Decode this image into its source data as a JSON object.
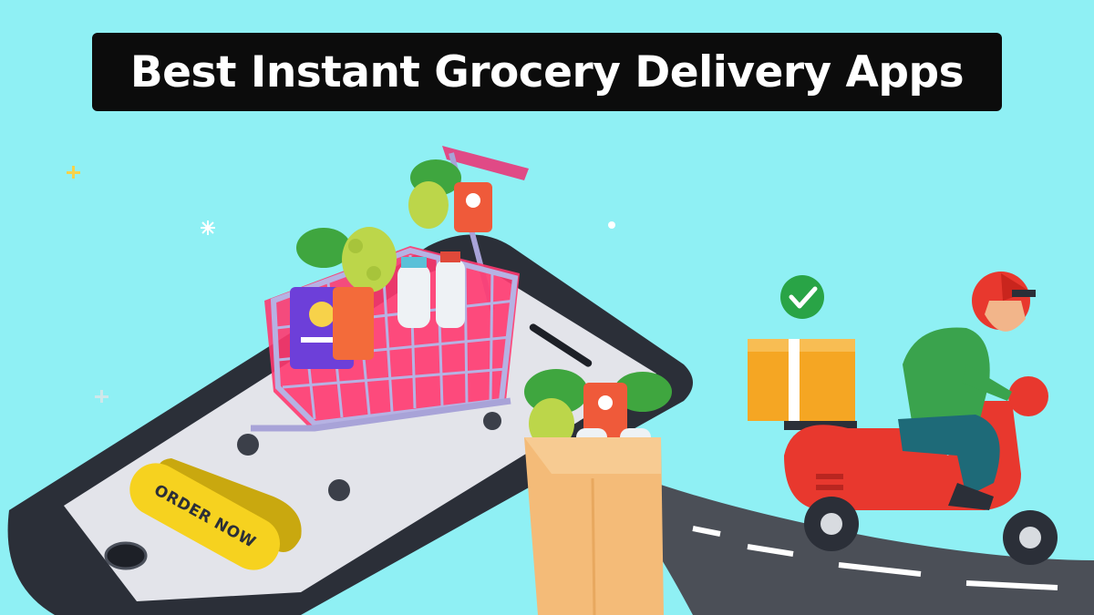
{
  "banner": {
    "title": "Best Instant Grocery Delivery Apps"
  },
  "phone": {
    "order_button_label": "ORDER NOW"
  },
  "icons": [
    "sparkle-icon",
    "check-circle-icon",
    "shopping-cart-icon",
    "grocery-bag-icon",
    "delivery-box-icon",
    "scooter-icon",
    "helmet-icon"
  ],
  "colors": {
    "background": "#8ff0f4",
    "title_bar": "#0c0c0c",
    "order_button": "#f6d21f",
    "scooter": "#e8382e",
    "check": "#2ea84a",
    "box": "#f5a623"
  }
}
